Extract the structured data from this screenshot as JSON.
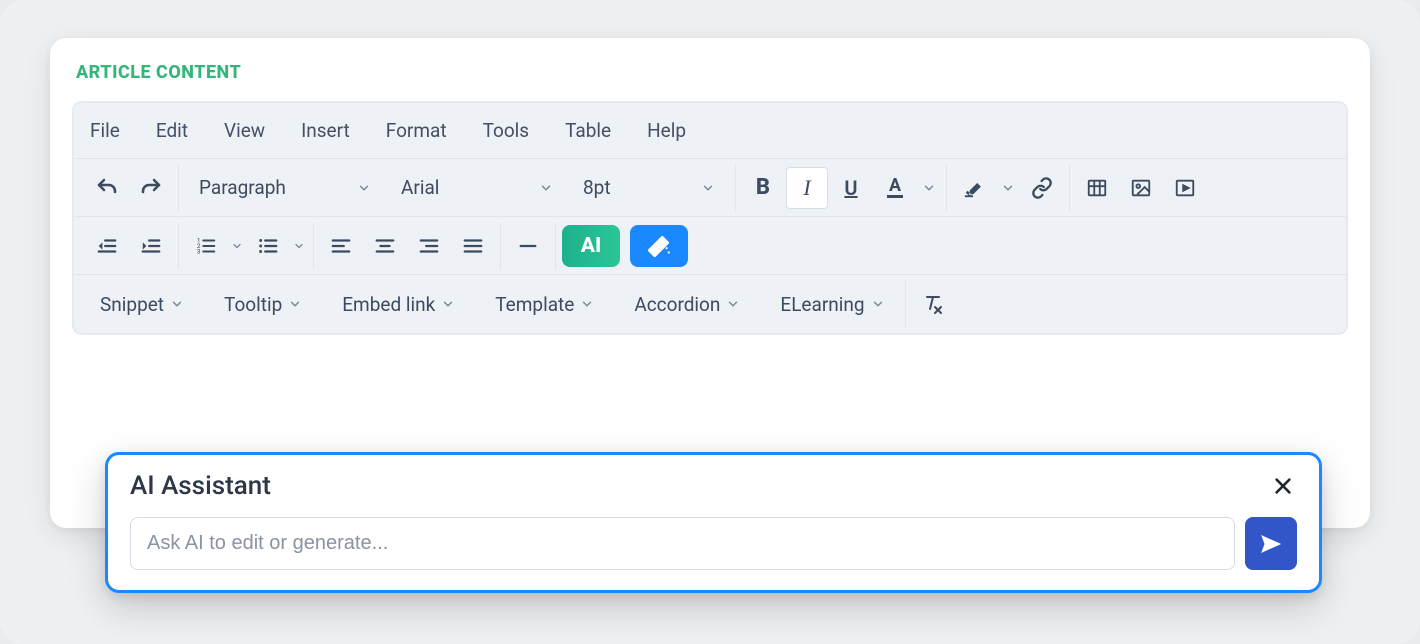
{
  "section_title": "ARTICLE CONTENT",
  "menubar": {
    "file": "File",
    "edit": "Edit",
    "view": "View",
    "insert": "Insert",
    "format": "Format",
    "tools": "Tools",
    "table": "Table",
    "help": "Help"
  },
  "toolbar": {
    "block_format": "Paragraph",
    "font_family": "Arial",
    "font_size": "8pt",
    "ai_label": "AI"
  },
  "dropdowns": {
    "snippet": "Snippet",
    "tooltip": "Tooltip",
    "embed_link": "Embed link",
    "template": "Template",
    "accordion": "Accordion",
    "elearning": "ELearning"
  },
  "ai_panel": {
    "title": "AI Assistant",
    "placeholder": "Ask AI to edit or generate..."
  }
}
